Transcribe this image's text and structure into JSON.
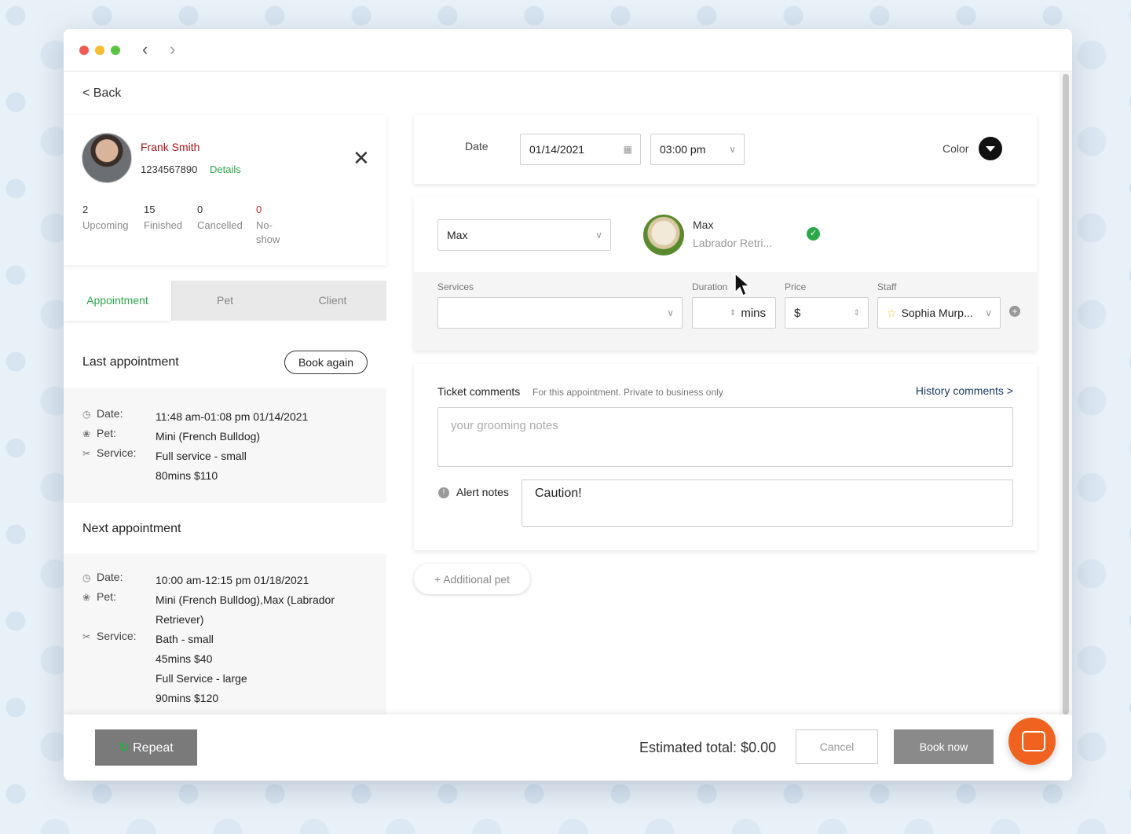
{
  "nav": {
    "back_label": "< Back"
  },
  "client": {
    "name": "Frank Smith",
    "phone": "1234567890",
    "details_label": "Details",
    "stats": [
      {
        "value": "2",
        "label": "Upcoming"
      },
      {
        "value": "15",
        "label": "Finished"
      },
      {
        "value": "0",
        "label": "Cancelled"
      },
      {
        "value": "0",
        "label": "No-show"
      }
    ]
  },
  "tabs": [
    "Appointment",
    "Pet",
    "Client"
  ],
  "last_appointment": {
    "title": "Last appointment",
    "book_again_label": "Book again",
    "date_label": "Date:",
    "date": "11:48 am-01:08 pm 01/14/2021",
    "pet_label": "Pet:",
    "pet": "Mini (French Bulldog)",
    "service_label": "Service:",
    "service": "Full service - small",
    "service_detail": "80mins  $110"
  },
  "next_appointment": {
    "title": "Next appointment",
    "date_label": "Date:",
    "date": "10:00 am-12:15 pm 01/18/2021",
    "pet_label": "Pet:",
    "pet": "Mini (French Bulldog),Max (Labrador Retriever)",
    "service_label": "Service:",
    "services": [
      "Bath - small",
      "45mins  $40",
      "Full Service - large",
      "90mins  $120"
    ]
  },
  "booking": {
    "date_label": "Date",
    "date_value": "01/14/2021",
    "time_value": "03:00 pm",
    "color_label": "Color"
  },
  "pet": {
    "select_value": "Max",
    "name": "Max",
    "breed": "Labrador Retri...",
    "services_label": "Services",
    "duration_label": "Duration",
    "duration_unit": "mins",
    "price_label": "Price",
    "price_prefix": "$",
    "staff_label": "Staff",
    "staff_value": "Sophia Murp..."
  },
  "ticket": {
    "title": "Ticket comments",
    "subtitle": "For this appointment. Private to business only",
    "history_label": "History comments >",
    "placeholder": "your grooming notes",
    "alert_label": "Alert notes",
    "alert_value": "Caution!"
  },
  "additional_pet_label": "+ Additional pet",
  "footer": {
    "repeat_label": "Repeat",
    "estimated_total": "Estimated total: $0.00",
    "cancel_label": "Cancel",
    "book_now_label": "Book now"
  },
  "colors": {
    "accent_green": "#2aa84a",
    "client_red": "#a4161a",
    "chat_orange": "#f0621f"
  }
}
